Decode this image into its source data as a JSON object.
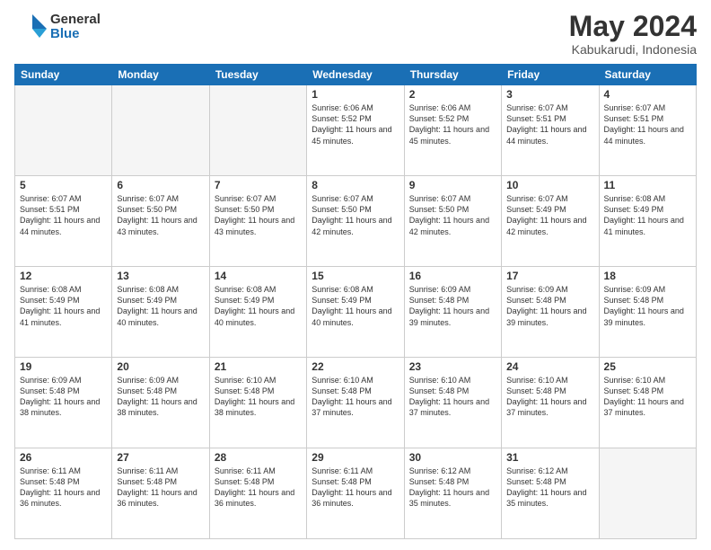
{
  "logo": {
    "general": "General",
    "blue": "Blue"
  },
  "title": {
    "month": "May 2024",
    "location": "Kabukarudi, Indonesia"
  },
  "weekdays": [
    "Sunday",
    "Monday",
    "Tuesday",
    "Wednesday",
    "Thursday",
    "Friday",
    "Saturday"
  ],
  "weeks": [
    [
      {
        "day": null
      },
      {
        "day": null
      },
      {
        "day": null
      },
      {
        "day": 1,
        "sunrise": "6:06 AM",
        "sunset": "5:52 PM",
        "daylight": "11 hours and 45 minutes."
      },
      {
        "day": 2,
        "sunrise": "6:06 AM",
        "sunset": "5:52 PM",
        "daylight": "11 hours and 45 minutes."
      },
      {
        "day": 3,
        "sunrise": "6:07 AM",
        "sunset": "5:51 PM",
        "daylight": "11 hours and 44 minutes."
      },
      {
        "day": 4,
        "sunrise": "6:07 AM",
        "sunset": "5:51 PM",
        "daylight": "11 hours and 44 minutes."
      }
    ],
    [
      {
        "day": 5,
        "sunrise": "6:07 AM",
        "sunset": "5:51 PM",
        "daylight": "11 hours and 44 minutes."
      },
      {
        "day": 6,
        "sunrise": "6:07 AM",
        "sunset": "5:50 PM",
        "daylight": "11 hours and 43 minutes."
      },
      {
        "day": 7,
        "sunrise": "6:07 AM",
        "sunset": "5:50 PM",
        "daylight": "11 hours and 43 minutes."
      },
      {
        "day": 8,
        "sunrise": "6:07 AM",
        "sunset": "5:50 PM",
        "daylight": "11 hours and 42 minutes."
      },
      {
        "day": 9,
        "sunrise": "6:07 AM",
        "sunset": "5:50 PM",
        "daylight": "11 hours and 42 minutes."
      },
      {
        "day": 10,
        "sunrise": "6:07 AM",
        "sunset": "5:49 PM",
        "daylight": "11 hours and 42 minutes."
      },
      {
        "day": 11,
        "sunrise": "6:08 AM",
        "sunset": "5:49 PM",
        "daylight": "11 hours and 41 minutes."
      }
    ],
    [
      {
        "day": 12,
        "sunrise": "6:08 AM",
        "sunset": "5:49 PM",
        "daylight": "11 hours and 41 minutes."
      },
      {
        "day": 13,
        "sunrise": "6:08 AM",
        "sunset": "5:49 PM",
        "daylight": "11 hours and 40 minutes."
      },
      {
        "day": 14,
        "sunrise": "6:08 AM",
        "sunset": "5:49 PM",
        "daylight": "11 hours and 40 minutes."
      },
      {
        "day": 15,
        "sunrise": "6:08 AM",
        "sunset": "5:49 PM",
        "daylight": "11 hours and 40 minutes."
      },
      {
        "day": 16,
        "sunrise": "6:09 AM",
        "sunset": "5:48 PM",
        "daylight": "11 hours and 39 minutes."
      },
      {
        "day": 17,
        "sunrise": "6:09 AM",
        "sunset": "5:48 PM",
        "daylight": "11 hours and 39 minutes."
      },
      {
        "day": 18,
        "sunrise": "6:09 AM",
        "sunset": "5:48 PM",
        "daylight": "11 hours and 39 minutes."
      }
    ],
    [
      {
        "day": 19,
        "sunrise": "6:09 AM",
        "sunset": "5:48 PM",
        "daylight": "11 hours and 38 minutes."
      },
      {
        "day": 20,
        "sunrise": "6:09 AM",
        "sunset": "5:48 PM",
        "daylight": "11 hours and 38 minutes."
      },
      {
        "day": 21,
        "sunrise": "6:10 AM",
        "sunset": "5:48 PM",
        "daylight": "11 hours and 38 minutes."
      },
      {
        "day": 22,
        "sunrise": "6:10 AM",
        "sunset": "5:48 PM",
        "daylight": "11 hours and 37 minutes."
      },
      {
        "day": 23,
        "sunrise": "6:10 AM",
        "sunset": "5:48 PM",
        "daylight": "11 hours and 37 minutes."
      },
      {
        "day": 24,
        "sunrise": "6:10 AM",
        "sunset": "5:48 PM",
        "daylight": "11 hours and 37 minutes."
      },
      {
        "day": 25,
        "sunrise": "6:10 AM",
        "sunset": "5:48 PM",
        "daylight": "11 hours and 37 minutes."
      }
    ],
    [
      {
        "day": 26,
        "sunrise": "6:11 AM",
        "sunset": "5:48 PM",
        "daylight": "11 hours and 36 minutes."
      },
      {
        "day": 27,
        "sunrise": "6:11 AM",
        "sunset": "5:48 PM",
        "daylight": "11 hours and 36 minutes."
      },
      {
        "day": 28,
        "sunrise": "6:11 AM",
        "sunset": "5:48 PM",
        "daylight": "11 hours and 36 minutes."
      },
      {
        "day": 29,
        "sunrise": "6:11 AM",
        "sunset": "5:48 PM",
        "daylight": "11 hours and 36 minutes."
      },
      {
        "day": 30,
        "sunrise": "6:12 AM",
        "sunset": "5:48 PM",
        "daylight": "11 hours and 35 minutes."
      },
      {
        "day": 31,
        "sunrise": "6:12 AM",
        "sunset": "5:48 PM",
        "daylight": "11 hours and 35 minutes."
      },
      {
        "day": null
      }
    ]
  ]
}
